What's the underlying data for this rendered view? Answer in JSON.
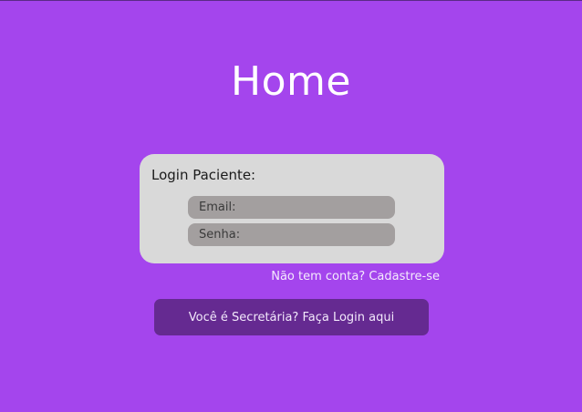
{
  "page": {
    "title": "Home"
  },
  "login_card": {
    "heading": "Login Paciente:",
    "email_placeholder": "Email:",
    "email_value": "",
    "password_placeholder": "Senha:",
    "password_value": ""
  },
  "register_link": "Não tem conta? Cadastre-se",
  "secretary_button": "Você é Secretária? Faça Login aqui",
  "colors": {
    "background": "#a445ed",
    "card": "#d9d9d9",
    "input": "#a39f9f",
    "button": "#652a91",
    "text_light": "#ffffff"
  }
}
